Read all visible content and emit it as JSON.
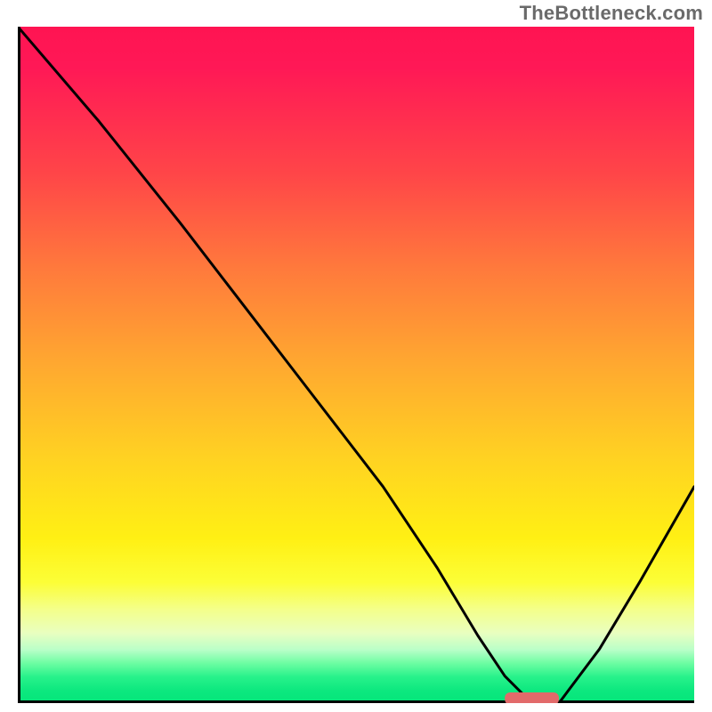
{
  "watermark": "TheBottleneck.com",
  "chart_data": {
    "type": "line",
    "title": "",
    "xlabel": "",
    "ylabel": "",
    "xlim": [
      0,
      100
    ],
    "ylim": [
      0,
      100
    ],
    "grid": false,
    "background": "gradient red-yellow-green top-to-bottom",
    "line_color": "#000000",
    "series": [
      {
        "name": "bottleneck-curve",
        "x": [
          0,
          12,
          24,
          34,
          44,
          54,
          62,
          68,
          72,
          76,
          80,
          86,
          92,
          100
        ],
        "y": [
          100,
          86,
          71,
          58,
          45,
          32,
          20,
          10,
          4,
          0,
          0,
          8,
          18,
          32
        ]
      }
    ],
    "marker": {
      "name": "optimal-range",
      "x_start": 72,
      "x_end": 80,
      "y": 0,
      "color": "#e26a6a"
    }
  }
}
